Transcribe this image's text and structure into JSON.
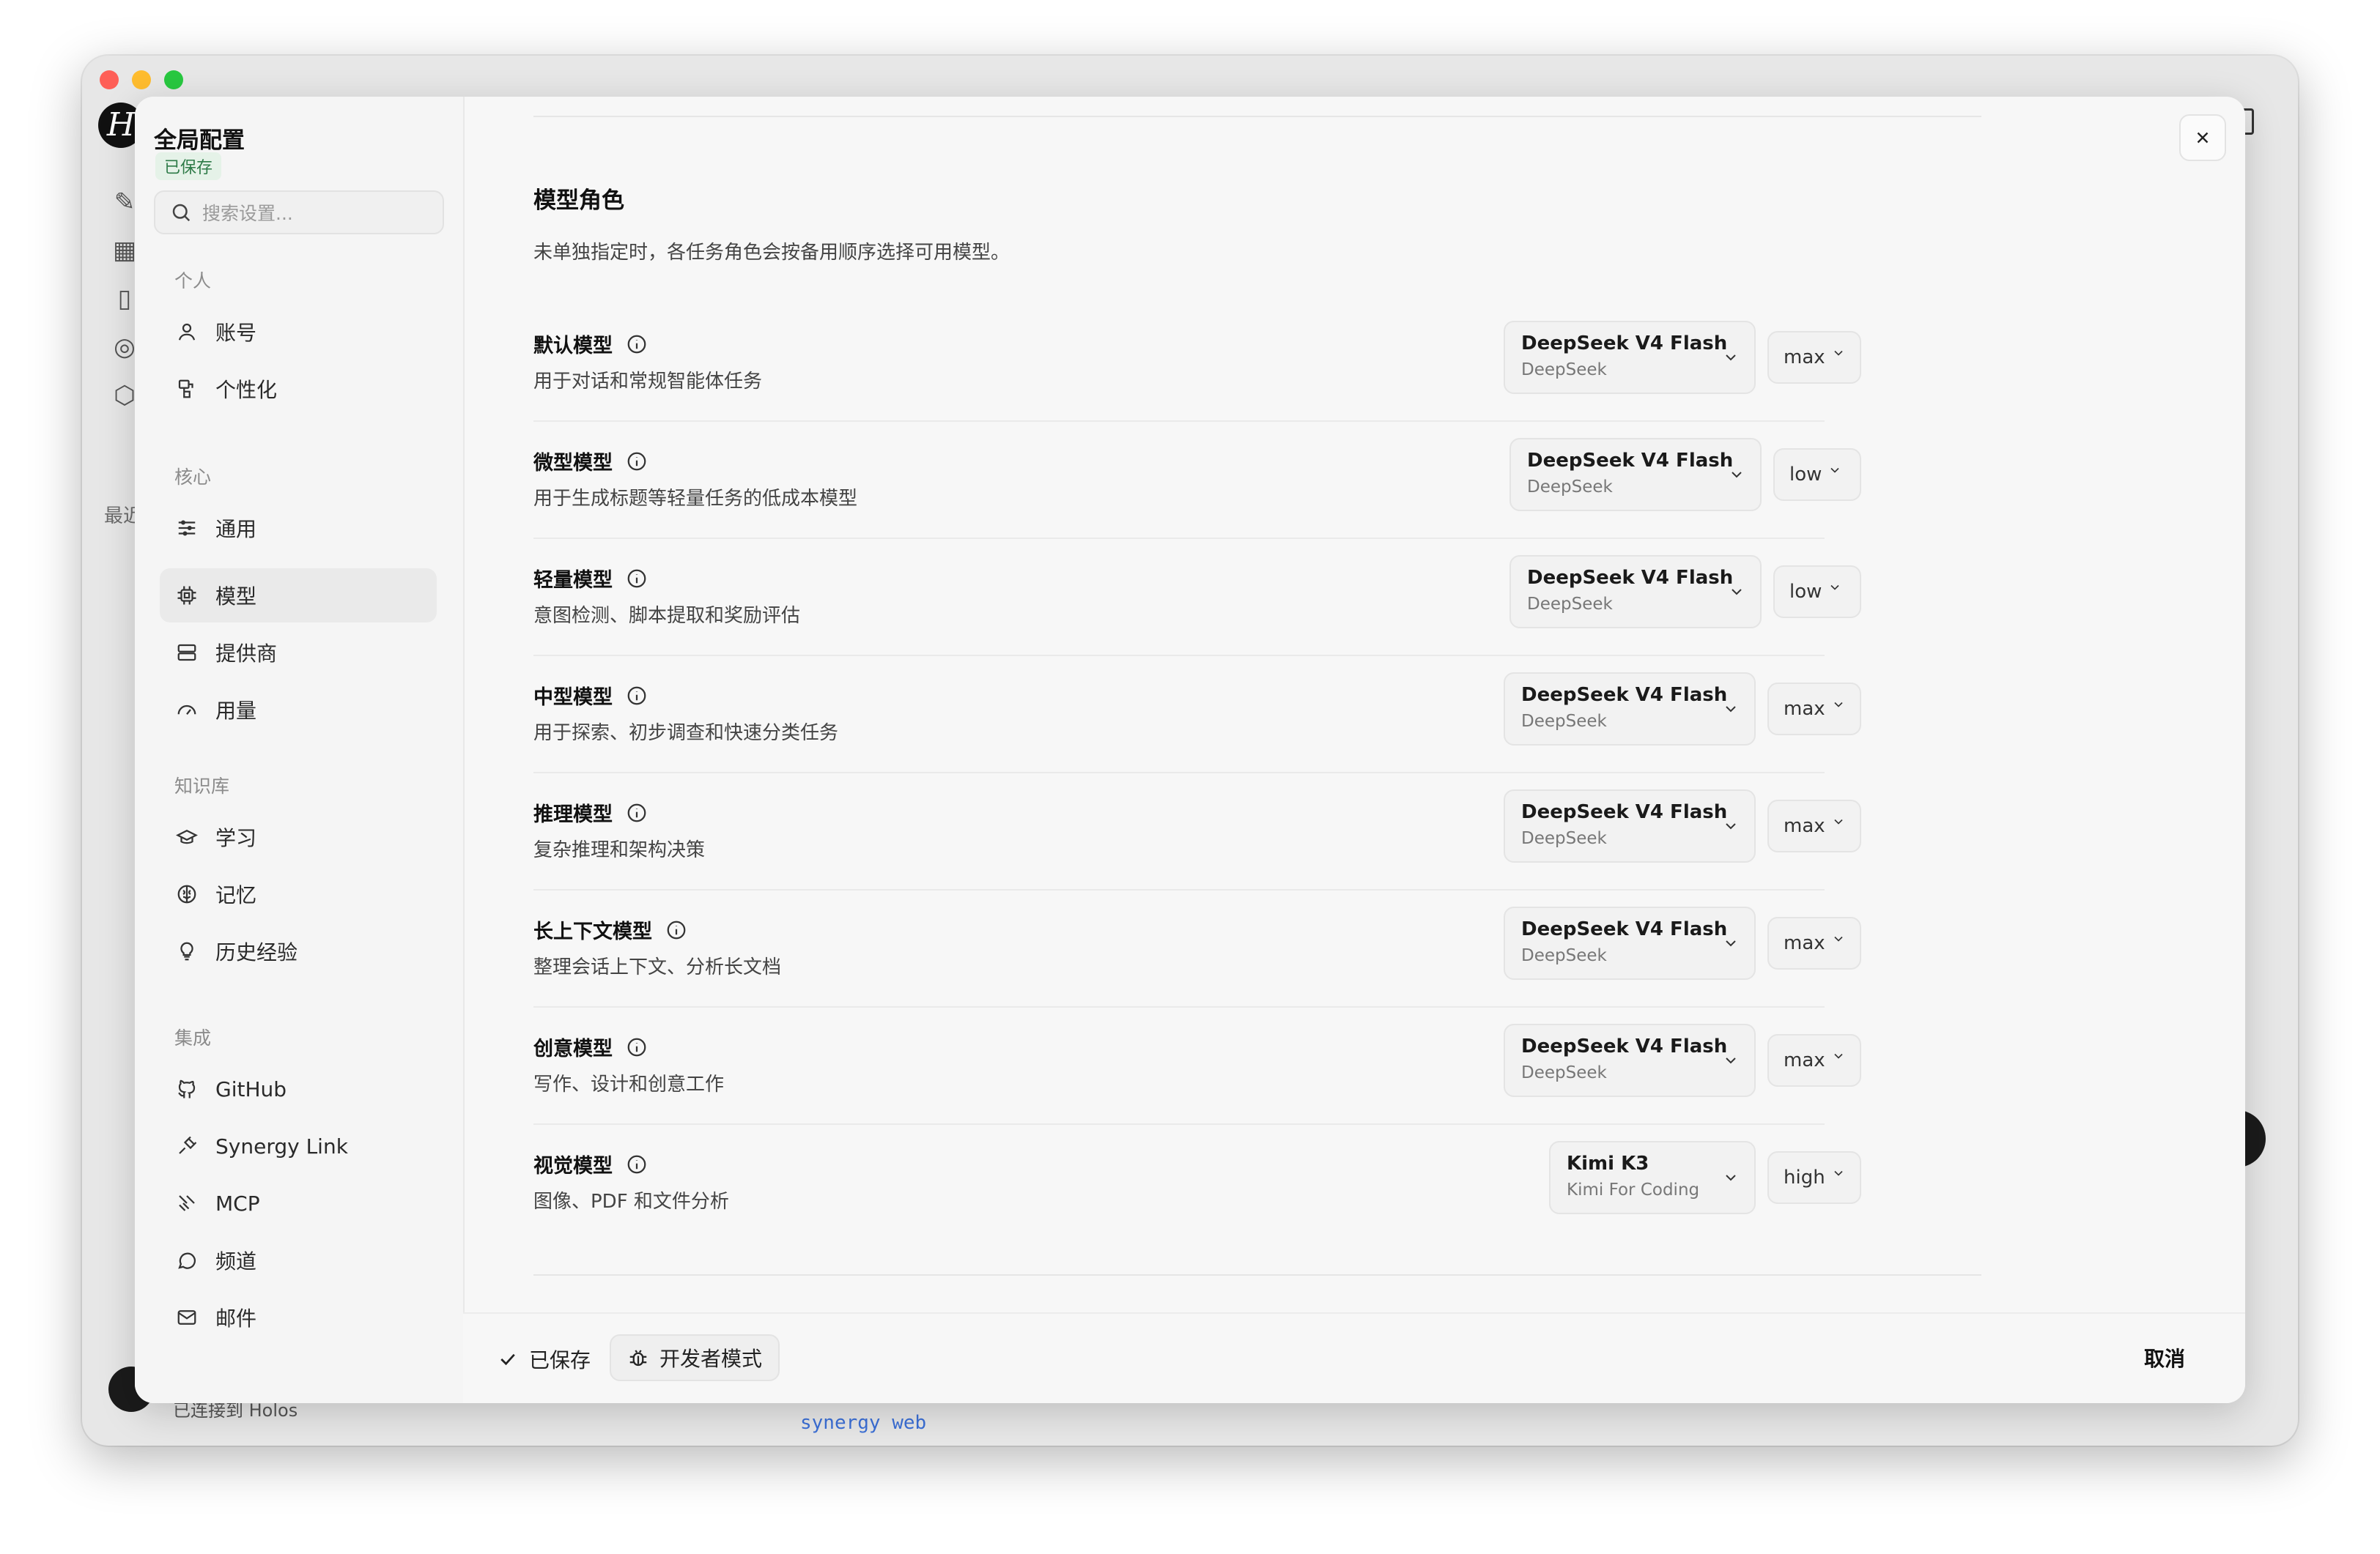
{
  "app": {
    "logo_letter": "H",
    "recent_label": "最近",
    "status_text": "已连接到 Holos",
    "code_snippet": "synergy web"
  },
  "modal": {
    "title": "全局配置",
    "saved_badge": "已保存",
    "search_placeholder": "搜索设置...",
    "groups": {
      "personal": "个人",
      "core": "核心",
      "knowledge": "知识库",
      "integrations": "集成"
    },
    "nav": {
      "account": "账号",
      "personalization": "个性化",
      "general": "通用",
      "models": "模型",
      "providers": "提供商",
      "usage": "用量",
      "learning": "学习",
      "memory": "记忆",
      "history": "历史经验",
      "github": "GitHub",
      "synergy_link": "Synergy Link",
      "mcp": "MCP",
      "channels": "频道",
      "mail": "邮件"
    },
    "section_title": "模型角色",
    "section_desc": "未单独指定时，各任务角色会按备用顺序选择可用模型。",
    "roles": [
      {
        "name": "默认模型",
        "desc": "用于对话和常规智能体任务",
        "model": "DeepSeek V4 Flash",
        "provider": "DeepSeek",
        "effort": "max"
      },
      {
        "name": "微型模型",
        "desc": "用于生成标题等轻量任务的低成本模型",
        "model": "DeepSeek V4 Flash",
        "provider": "DeepSeek",
        "effort": "low"
      },
      {
        "name": "轻量模型",
        "desc": "意图检测、脚本提取和奖励评估",
        "model": "DeepSeek V4 Flash",
        "provider": "DeepSeek",
        "effort": "low"
      },
      {
        "name": "中型模型",
        "desc": "用于探索、初步调查和快速分类任务",
        "model": "DeepSeek V4 Flash",
        "provider": "DeepSeek",
        "effort": "max"
      },
      {
        "name": "推理模型",
        "desc": "复杂推理和架构决策",
        "model": "DeepSeek V4 Flash",
        "provider": "DeepSeek",
        "effort": "max"
      },
      {
        "name": "长上下文模型",
        "desc": "整理会话上下文、分析长文档",
        "model": "DeepSeek V4 Flash",
        "provider": "DeepSeek",
        "effort": "max"
      },
      {
        "name": "创意模型",
        "desc": "写作、设计和创意工作",
        "model": "DeepSeek V4 Flash",
        "provider": "DeepSeek",
        "effort": "max"
      },
      {
        "name": "视觉模型",
        "desc": "图像、PDF 和文件分析",
        "model": "Kimi K3",
        "provider": "Kimi For Coding",
        "effort": "high"
      }
    ],
    "footer": {
      "saved_label": "已保存",
      "dev_mode_label": "开发者模式",
      "cancel_label": "取消"
    }
  }
}
